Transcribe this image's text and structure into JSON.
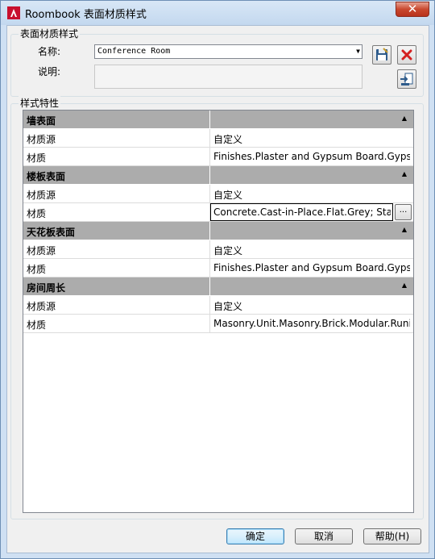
{
  "window": {
    "title": "Roombook 表面材质样式",
    "close_label": "✕"
  },
  "style_group": {
    "label": "表面材质样式",
    "name_label": "名称:",
    "name_value": "Conference Room",
    "description_label": "说明:",
    "description_value": ""
  },
  "properties": {
    "label": "样式特性",
    "rows": [
      {
        "kind": "category",
        "name": "墙表面"
      },
      {
        "kind": "property",
        "name": "材质源",
        "value": "自定义"
      },
      {
        "kind": "property",
        "name": "材质",
        "value": "Finishes.Plaster and Gypsum Board.Gypsu"
      },
      {
        "kind": "category",
        "name": "楼板表面"
      },
      {
        "kind": "property",
        "name": "材质源",
        "value": "自定义"
      },
      {
        "kind": "property",
        "name": "材质",
        "value": "Concrete.Cast-in-Place.Flat.Grey; Stand",
        "editing": true,
        "browse_label": "..."
      },
      {
        "kind": "category",
        "name": "天花板表面"
      },
      {
        "kind": "property",
        "name": "材质源",
        "value": "自定义"
      },
      {
        "kind": "property",
        "name": "材质",
        "value": "Finishes.Plaster and Gypsum Board.Gypsu"
      },
      {
        "kind": "category",
        "name": "房间周长"
      },
      {
        "kind": "property",
        "name": "材质源",
        "value": "自定义"
      },
      {
        "kind": "property",
        "name": "材质",
        "value": "Masonry.Unit.Masonry.Brick.Modular.Runi"
      }
    ]
  },
  "buttons": {
    "ok": "确定",
    "cancel": "取消",
    "help": "帮助(H)"
  },
  "icons": {
    "save": "save-icon",
    "delete": "delete-icon",
    "import": "import-icon"
  },
  "colors": {
    "category_row": "#acacac",
    "delete_red": "#d42020"
  }
}
